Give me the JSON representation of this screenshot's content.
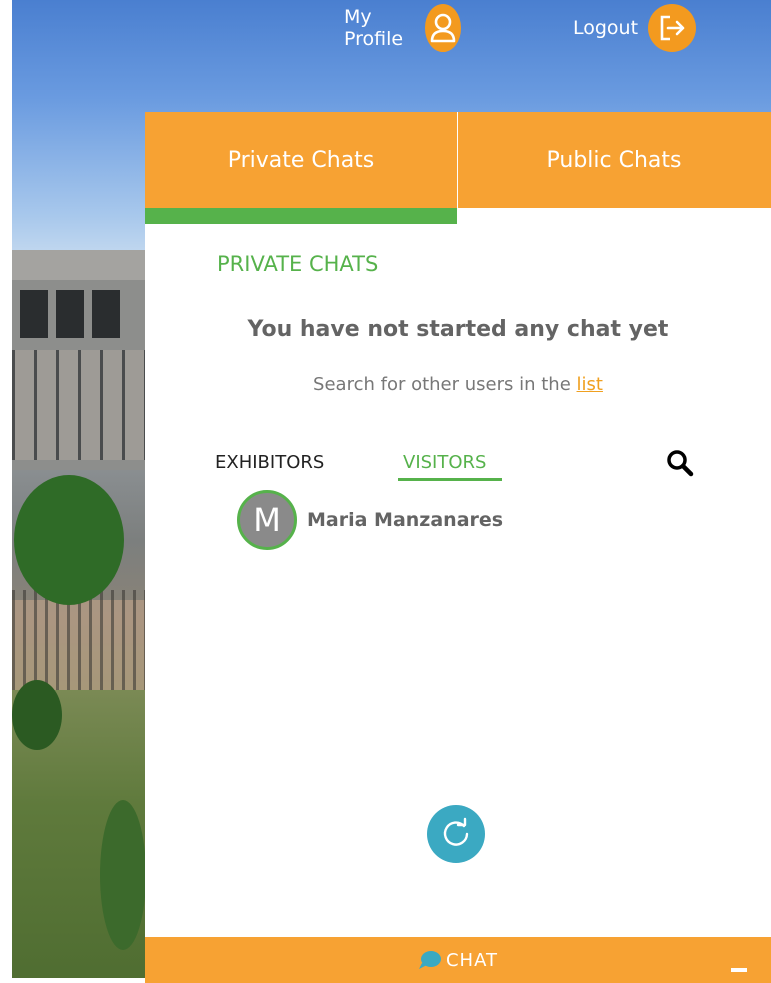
{
  "header": {
    "profile_label": "My Profile",
    "logout_label": "Logout"
  },
  "chat_panel": {
    "tabs": [
      {
        "label": "Private Chats",
        "active": true
      },
      {
        "label": "Public Chats",
        "active": false
      }
    ],
    "section_title": "PRIVATE CHATS",
    "empty_title": "You have not started any chat yet",
    "empty_sub_prefix": "Search for other users in the ",
    "empty_sub_link": "list",
    "subtabs": [
      {
        "label": "EXHIBITORS",
        "active": false
      },
      {
        "label": "VISITORS",
        "active": true
      }
    ],
    "users": [
      {
        "initial": "M",
        "name": "Maria Manzanares"
      }
    ]
  },
  "chat_bar": {
    "label": "CHAT"
  },
  "colors": {
    "orange": "#f7a233",
    "green": "#56b24b",
    "teal": "#3ba9c2"
  }
}
